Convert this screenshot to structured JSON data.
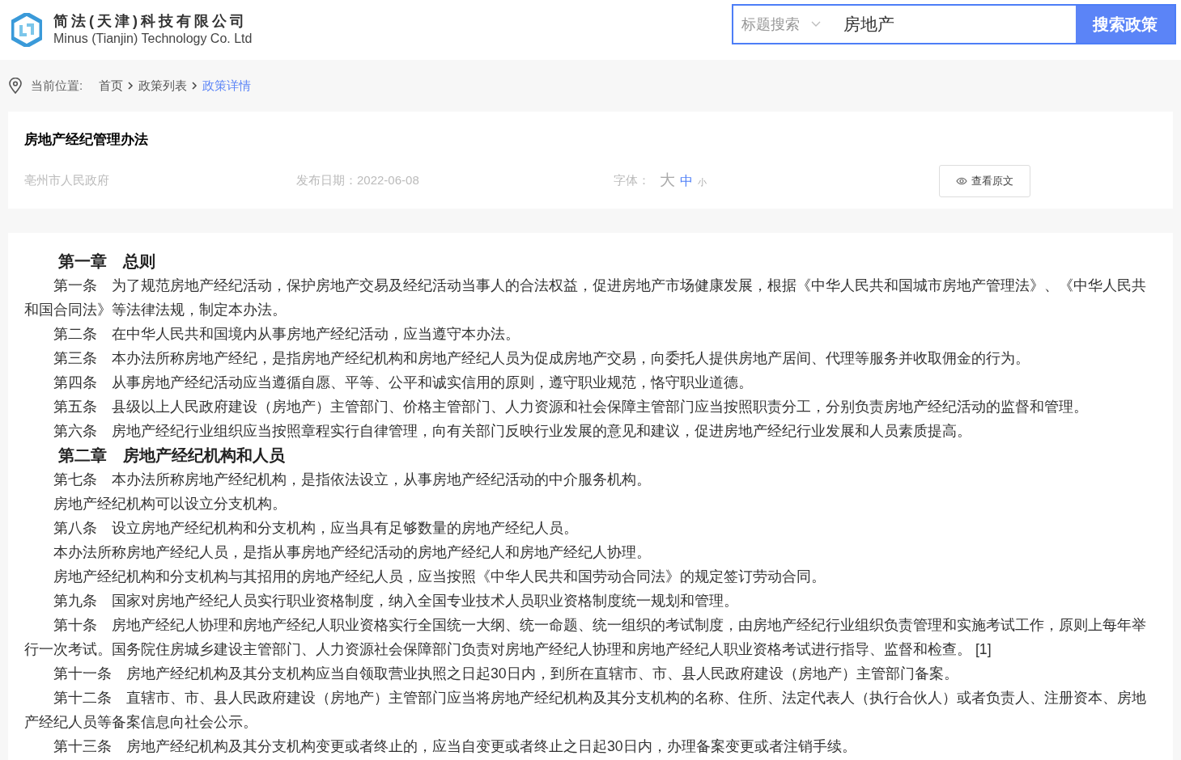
{
  "header": {
    "company_name": "简法(天津)科技有限公司",
    "company_name_en": "Minus (Tianjin) Technology Co. Ltd",
    "search": {
      "scope": "标题搜索",
      "value": "房地产",
      "button": "搜索政策"
    }
  },
  "breadcrumb": {
    "label": "当前位置:",
    "items": [
      {
        "text": "首页",
        "selected": false
      },
      {
        "text": "政策列表",
        "selected": false
      },
      {
        "text": "政策详情",
        "selected": true
      }
    ]
  },
  "policy": {
    "title": "房地产经纪管理办法",
    "issuer": "亳州市人民政府",
    "date": "发布日期：2022-06-08",
    "font_label": "字体：",
    "font_sizes": [
      {
        "text": "大",
        "selected": false
      },
      {
        "text": "中",
        "selected": true
      },
      {
        "text": "小",
        "selected": false
      }
    ],
    "view_original": "查看原文"
  },
  "content": [
    {
      "kind": "heading",
      "text": "第一章　总则"
    },
    {
      "kind": "paragraph",
      "text": "第一条　为了规范房地产经纪活动，保护房地产交易及经纪活动当事人的合法权益，促进房地产市场健康发展，根据《中华人民共和国城市房地产管理法》、《中华人民共和国合同法》等法律法规，制定本办法。"
    },
    {
      "kind": "paragraph",
      "text": "第二条　在中华人民共和国境内从事房地产经纪活动，应当遵守本办法。"
    },
    {
      "kind": "paragraph",
      "text": "第三条　本办法所称房地产经纪，是指房地产经纪机构和房地产经纪人员为促成房地产交易，向委托人提供房地产居间、代理等服务并收取佣金的行为。"
    },
    {
      "kind": "paragraph",
      "text": "第四条　从事房地产经纪活动应当遵循自愿、平等、公平和诚实信用的原则，遵守职业规范，恪守职业道德。"
    },
    {
      "kind": "paragraph",
      "text": "第五条　县级以上人民政府建设（房地产）主管部门、价格主管部门、人力资源和社会保障主管部门应当按照职责分工，分别负责房地产经纪活动的监督和管理。"
    },
    {
      "kind": "paragraph",
      "text": "第六条　房地产经纪行业组织应当按照章程实行自律管理，向有关部门反映行业发展的意见和建议，促进房地产经纪行业发展和人员素质提高。"
    },
    {
      "kind": "heading",
      "text": "第二章　房地产经纪机构和人员"
    },
    {
      "kind": "paragraph",
      "text": "第七条　本办法所称房地产经纪机构，是指依法设立，从事房地产经纪活动的中介服务机构。"
    },
    {
      "kind": "paragraph",
      "text": "房地产经纪机构可以设立分支机构。"
    },
    {
      "kind": "paragraph",
      "text": "第八条　设立房地产经纪机构和分支机构，应当具有足够数量的房地产经纪人员。"
    },
    {
      "kind": "paragraph",
      "text": "本办法所称房地产经纪人员，是指从事房地产经纪活动的房地产经纪人和房地产经纪人协理。"
    },
    {
      "kind": "paragraph",
      "text": "房地产经纪机构和分支机构与其招用的房地产经纪人员，应当按照《中华人民共和国劳动合同法》的规定签订劳动合同。"
    },
    {
      "kind": "paragraph",
      "text": "第九条　国家对房地产经纪人员实行职业资格制度，纳入全国专业技术人员职业资格制度统一规划和管理。"
    },
    {
      "kind": "paragraph",
      "text": "第十条　房地产经纪人协理和房地产经纪人职业资格实行全国统一大纲、统一命题、统一组织的考试制度，由房地产经纪行业组织负责管理和实施考试工作，原则上每年举行一次考试。国务院住房城乡建设主管部门、人力资源社会保障部门负责对房地产经纪人协理和房地产经纪人职业资格考试进行指导、监督和检查。 [1]"
    },
    {
      "kind": "paragraph",
      "text": "第十一条　房地产经纪机构及其分支机构应当自领取营业执照之日起30日内，到所在直辖市、市、县人民政府建设（房地产）主管部门备案。"
    },
    {
      "kind": "paragraph",
      "text": "第十二条　直辖市、市、县人民政府建设（房地产）主管部门应当将房地产经纪机构及其分支机构的名称、住所、法定代表人（执行合伙人）或者负责人、注册资本、房地产经纪人员等备案信息向社会公示。"
    },
    {
      "kind": "paragraph",
      "text": "第十三条　房地产经纪机构及其分支机构变更或者终止的，应当自变更或者终止之日起30日内，办理备案变更或者注销手续。"
    }
  ]
}
